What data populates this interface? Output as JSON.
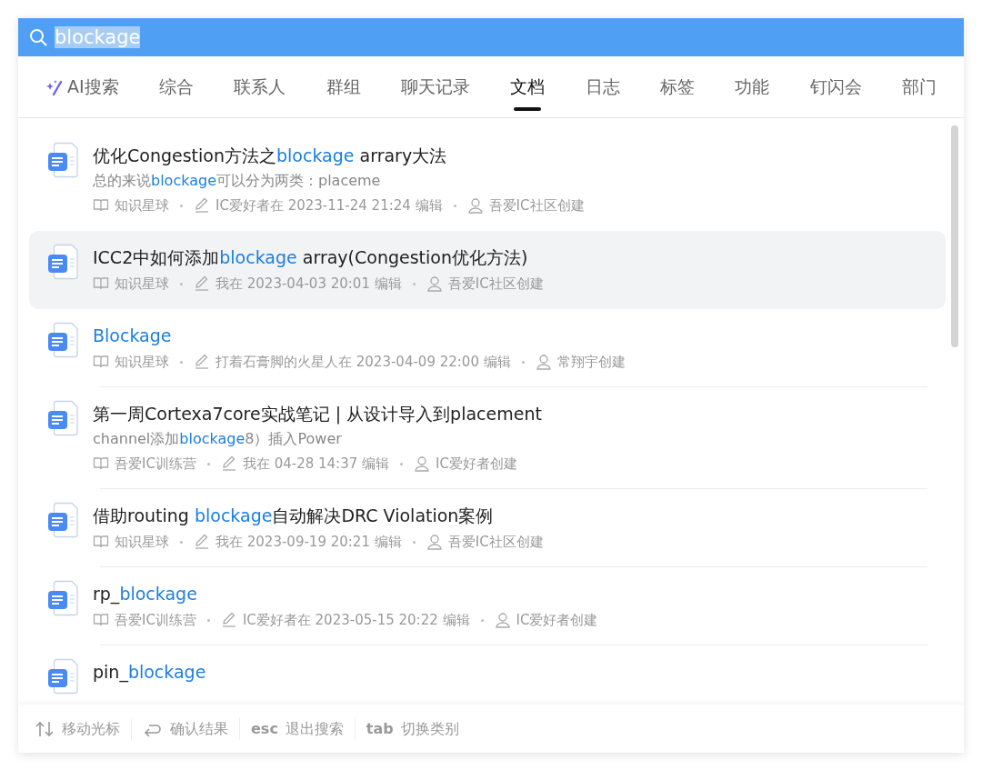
{
  "search": {
    "value": "blockage",
    "selected_text": true
  },
  "tabs": [
    {
      "label": "AI搜索",
      "kind": "ai",
      "selected": false
    },
    {
      "label": "综合",
      "selected": false
    },
    {
      "label": "联系人",
      "selected": false
    },
    {
      "label": "群组",
      "selected": false
    },
    {
      "label": "聊天记录",
      "selected": false
    },
    {
      "label": "文档",
      "selected": true
    },
    {
      "label": "日志",
      "selected": false
    },
    {
      "label": "标签",
      "selected": false
    },
    {
      "label": "功能",
      "selected": false
    },
    {
      "label": "钉闪会",
      "selected": false
    },
    {
      "label": "部门",
      "selected": false
    }
  ],
  "results": [
    {
      "title": [
        {
          "text": "优化Congestion方法之",
          "hit": false
        },
        {
          "text": "blockage",
          "hit": true
        },
        {
          "text": " arrary大法",
          "hit": false
        }
      ],
      "snippet": [
        {
          "text": "总的来说",
          "hit": false
        },
        {
          "text": "blockage",
          "hit": true
        },
        {
          "text": "可以分为两类：placeme",
          "hit": false
        }
      ],
      "source": "知识星球",
      "edited": "IC爱好者在 2023-11-24 21:24 编辑",
      "creator": "吾爱IC社区创建",
      "selected": false
    },
    {
      "title": [
        {
          "text": "ICC2中如何添加",
          "hit": false
        },
        {
          "text": "blockage",
          "hit": true
        },
        {
          "text": " array(Congestion优化方法)",
          "hit": false
        }
      ],
      "source": "知识星球",
      "edited": "我在 2023-04-03 20:01 编辑",
      "creator": "吾爱IC社区创建",
      "selected": true
    },
    {
      "title": [
        {
          "text": "Blockage",
          "hit": true
        }
      ],
      "source": "知识星球",
      "edited": "打着石膏脚的火星人在 2023-04-09 22:00 编辑",
      "creator": "常翔宇创建",
      "selected": false
    },
    {
      "title": [
        {
          "text": "第一周Cortexa7core实战笔记 | 从设计导入到placement",
          "hit": false
        }
      ],
      "snippet": [
        {
          "text": "channel添加",
          "hit": false
        },
        {
          "text": "blockage",
          "hit": true
        },
        {
          "text": "8）插入Power",
          "hit": false
        }
      ],
      "source": "吾爱IC训练营",
      "edited": "我在 04-28 14:37 编辑",
      "creator": "IC爱好者创建",
      "selected": false
    },
    {
      "title": [
        {
          "text": "借助routing ",
          "hit": false
        },
        {
          "text": "blockage",
          "hit": true
        },
        {
          "text": "自动解决DRC Violation案例",
          "hit": false
        }
      ],
      "source": "知识星球",
      "edited": "我在 2023-09-19 20:21 编辑",
      "creator": "吾爱IC社区创建",
      "selected": false
    },
    {
      "title": [
        {
          "text": "rp_",
          "hit": false
        },
        {
          "text": "blockage",
          "hit": true
        }
      ],
      "source": "吾爱IC训练营",
      "edited": "IC爱好者在 2023-05-15 20:22 编辑",
      "creator": "IC爱好者创建",
      "selected": false
    },
    {
      "title": [
        {
          "text": "pin_",
          "hit": false
        },
        {
          "text": "blockage",
          "hit": true
        }
      ],
      "selected": false
    }
  ],
  "footer": [
    {
      "kind": "arrows",
      "label": "移动光标"
    },
    {
      "kind": "enter",
      "label": "确认结果"
    },
    {
      "kind": "key",
      "key": "esc",
      "label": "退出搜索"
    },
    {
      "kind": "key",
      "key": "tab",
      "label": "切换类别"
    }
  ]
}
